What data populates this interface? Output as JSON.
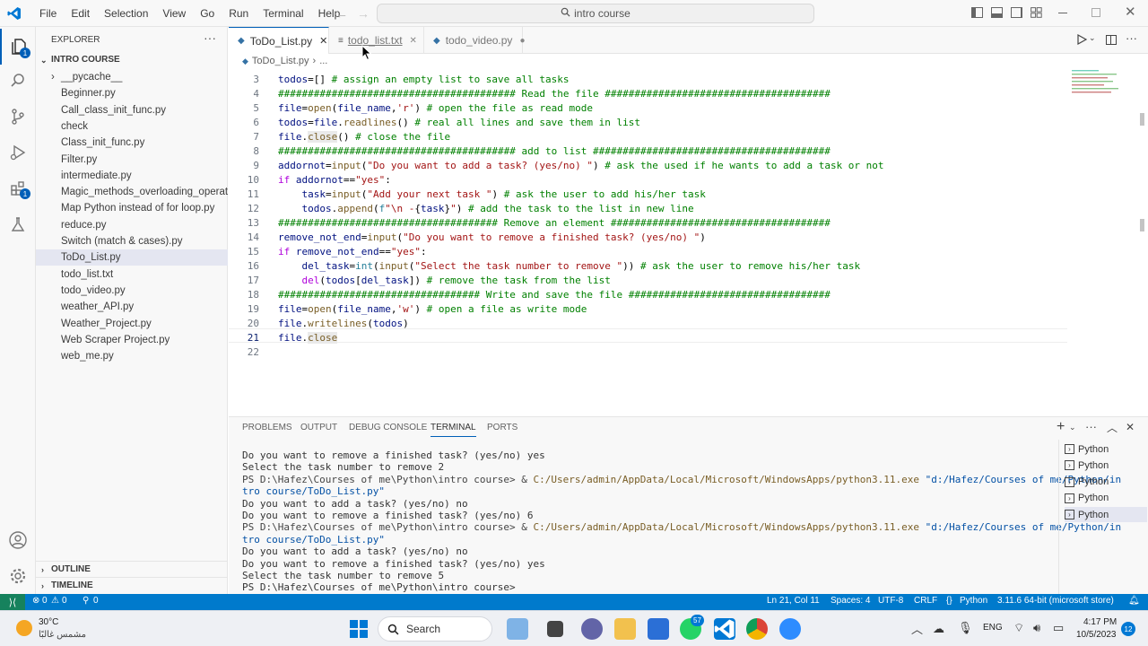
{
  "menu": [
    "File",
    "Edit",
    "Selection",
    "View",
    "Go",
    "Run",
    "Terminal",
    "Help"
  ],
  "command_center": "intro course",
  "explorer": {
    "title": "EXPLORER",
    "folder": "INTRO COURSE",
    "items": [
      "__pycache__",
      "Beginner.py",
      "Call_class_init_func.py",
      "check",
      "Class_init_func.py",
      "Filter.py",
      "intermediate.py",
      "Magic_methods_overloading_operat...",
      "Map Python instead of for loop.py",
      "reduce.py",
      "Switch (match & cases).py",
      "ToDo_List.py",
      "todo_list.txt",
      "todo_video.py",
      "weather_API.py",
      "Weather_Project.py",
      "Web Scraper Project.py",
      "web_me.py"
    ],
    "outline": "OUTLINE",
    "timeline": "TIMELINE"
  },
  "activity_badges": {
    "explorer": "1",
    "extensions": "1"
  },
  "tabs": [
    {
      "label": "ToDo_List.py",
      "state": "active"
    },
    {
      "label": "todo_list.txt",
      "state": "normal"
    },
    {
      "label": "todo_video.py",
      "state": "modified"
    }
  ],
  "breadcrumb": {
    "file": "ToDo_List.py",
    "rest": "..."
  },
  "code": {
    "line_numbers": [
      "3",
      "4",
      "5",
      "6",
      "7",
      "8",
      "9",
      "10",
      "11",
      "12",
      "13",
      "14",
      "15",
      "16",
      "17",
      "18",
      "19",
      "20",
      "21",
      "22"
    ]
  },
  "panel": {
    "tabs": [
      "PROBLEMS",
      "OUTPUT",
      "DEBUG CONSOLE",
      "TERMINAL",
      "PORTS"
    ],
    "active_tab": "TERMINAL",
    "terminal_lines": [
      "Do you want to remove a finished task? (yes/no) yes",
      "Select the task number to remove 2",
      "PS D:\\Hafez\\Courses of me\\Python\\intro course> & C:/Users/admin/AppData/Local/Microsoft/WindowsApps/python3.11.exe \"d:/Hafez/Courses of me/Python/in",
      "tro course/ToDo_List.py\"",
      "Do you want to add a task? (yes/no) no",
      "Do you want to remove a finished task? (yes/no) 6",
      "PS D:\\Hafez\\Courses of me\\Python\\intro course> & C:/Users/admin/AppData/Local/Microsoft/WindowsApps/python3.11.exe \"d:/Hafez/Courses of me/Python/in",
      "tro course/ToDo_List.py\"",
      "Do you want to add a task? (yes/no) no",
      "Do you want to remove a finished task? (yes/no) yes",
      "Select the task number to remove 5",
      "PS D:\\Hafez\\Courses of me\\Python\\intro course> "
    ],
    "terminals": [
      "Python",
      "Python",
      "Python",
      "Python",
      "Python"
    ]
  },
  "status": {
    "errors": "0",
    "warnings": "0",
    "ports": "0",
    "position": "Ln 21, Col 11",
    "spaces": "Spaces: 4",
    "encoding": "UTF-8",
    "eol": "CRLF",
    "language": "Python",
    "interpreter": "3.11.6 64-bit (microsoft store)"
  },
  "taskbar": {
    "weather_temp": "30°C",
    "weather_desc": "مشمس غالبًا",
    "search": "Search",
    "whatsapp_badge": "57",
    "lang": "ENG",
    "time": "4:17 PM",
    "date": "10/5/2023",
    "notif": "12"
  },
  "colors": {
    "accent": "#007acc",
    "activity_badge": "#005fb8"
  }
}
